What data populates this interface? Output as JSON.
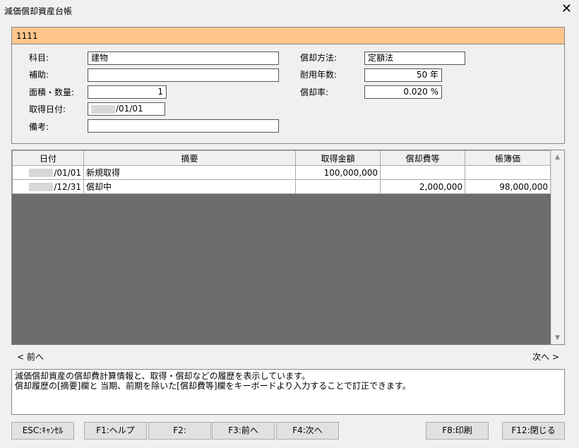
{
  "window": {
    "title": "減価償却資産台帳",
    "close_glyph": "✕"
  },
  "code": "1111",
  "form": {
    "kamoku_label": "科目:",
    "kamoku_value": "建物",
    "hojo_label": "補助:",
    "hojo_value": "",
    "menseki_label": "面積・数量:",
    "menseki_value": "1",
    "shutoku_label": "取得日付:",
    "shutoku_value": "/01/01",
    "biko_label": "備考:",
    "biko_value": "",
    "method_label": "償却方法:",
    "method_value": "定額法",
    "years_label": "耐用年数:",
    "years_value": "50 年",
    "rate_label": "償却率:",
    "rate_value": "0.020 %"
  },
  "table": {
    "headers": [
      "日付",
      "摘要",
      "取得金額",
      "償却費等",
      "帳簿価"
    ],
    "rows": [
      [
        "/01/01",
        "新規取得",
        "100,000,000",
        "",
        ""
      ],
      [
        "/12/31",
        "償却中",
        "",
        "2,000,000",
        "98,000,000"
      ]
    ]
  },
  "nav": {
    "prev": "< 前へ",
    "next": "次へ >"
  },
  "info": {
    "line1": "減価償却資産の償却費計算情報と、取得・償却などの履歴を表示しています。",
    "line2": "償却履歴の[摘要]欄と 当期、前期を除いた[償却費等]欄をキーボードより入力することで訂正できます。"
  },
  "buttons": {
    "esc": "ESC:ｷｬﾝｾﾙ",
    "f1": "F1:ヘルプ",
    "f2": "F2:",
    "f3": "F3:前へ",
    "f4": "F4:次へ",
    "f8": "F8:印刷",
    "f12": "F12:閉じる"
  }
}
